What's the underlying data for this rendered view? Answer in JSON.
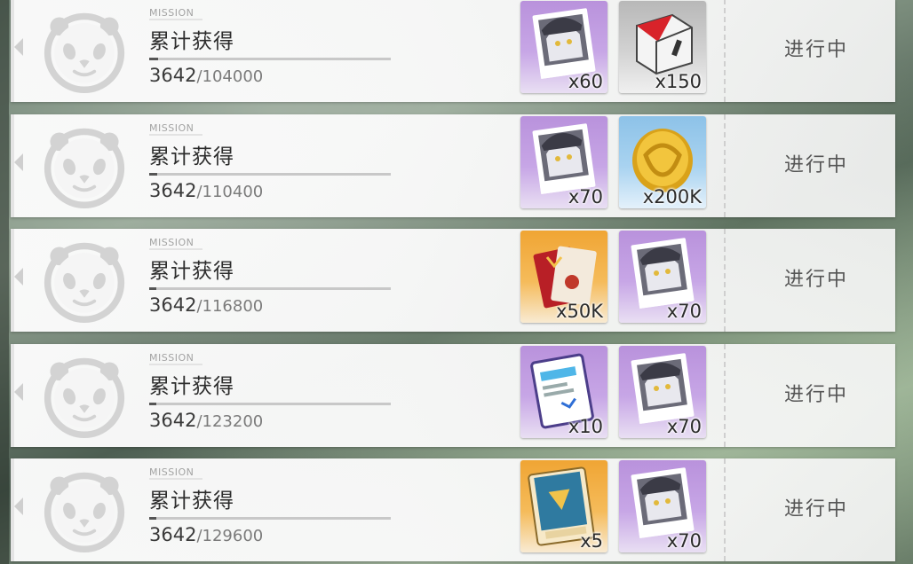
{
  "missions": [
    {
      "tag": "MISSION",
      "title": "累计获得",
      "current": "3642",
      "target": "104000",
      "progress_fraction": 0.035,
      "status": "进行中",
      "rewards": [
        {
          "icon": "character-card-icon",
          "bg": "purple",
          "qty": "x60"
        },
        {
          "icon": "red-white-cube-icon",
          "bg": "gray",
          "qty": "x150"
        }
      ]
    },
    {
      "tag": "MISSION",
      "title": "累计获得",
      "current": "3642",
      "target": "110400",
      "progress_fraction": 0.033,
      "status": "进行中",
      "rewards": [
        {
          "icon": "character-card-icon",
          "bg": "purple",
          "qty": "x70"
        },
        {
          "icon": "gold-coin-icon",
          "bg": "blue",
          "qty": "x200K"
        }
      ]
    },
    {
      "tag": "MISSION",
      "title": "累计获得",
      "current": "3642",
      "target": "116800",
      "progress_fraction": 0.031,
      "status": "进行中",
      "rewards": [
        {
          "icon": "ticket-icon",
          "bg": "orange",
          "qty": "x50K"
        },
        {
          "icon": "character-card-icon",
          "bg": "purple",
          "qty": "x70"
        }
      ]
    },
    {
      "tag": "MISSION",
      "title": "累计获得",
      "current": "3642",
      "target": "123200",
      "progress_fraction": 0.03,
      "status": "进行中",
      "rewards": [
        {
          "icon": "document-card-icon",
          "bg": "purple",
          "qty": "x10"
        },
        {
          "icon": "character-card-icon",
          "bg": "purple",
          "qty": "x70"
        }
      ]
    },
    {
      "tag": "MISSION",
      "title": "累计获得",
      "current": "3642",
      "target": "129600",
      "progress_fraction": 0.028,
      "status": "进行中",
      "rewards": [
        {
          "icon": "book-icon",
          "bg": "orange",
          "qty": "x5"
        },
        {
          "icon": "character-card-icon",
          "bg": "purple",
          "qty": "x70"
        }
      ]
    }
  ]
}
